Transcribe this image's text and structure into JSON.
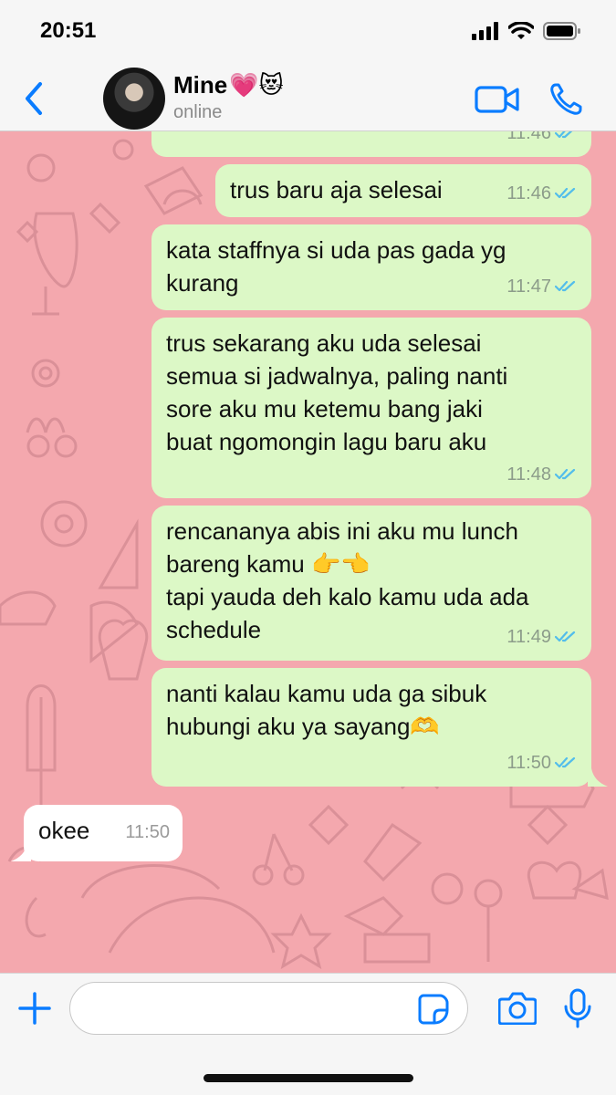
{
  "status_bar": {
    "time": "20:51"
  },
  "header": {
    "contact_name": "Mine",
    "contact_emoji": "💗😻",
    "status": "online"
  },
  "messages": [
    {
      "direction": "out",
      "text": "",
      "time": "11:46"
    },
    {
      "direction": "out",
      "text": "trus baru aja selesai",
      "time": "11:46"
    },
    {
      "direction": "out",
      "lines": [
        "kata staffnya si uda pas gada yg",
        "kurang"
      ],
      "time": "11:47"
    },
    {
      "direction": "out",
      "lines": [
        "trus sekarang aku uda selesai",
        "semua si jadwalnya, paling nanti",
        "sore aku mu ketemu bang jaki",
        "buat ngomongin lagu baru aku"
      ],
      "time": "11:48"
    },
    {
      "direction": "out",
      "lines": [
        "rencananya abis ini aku mu lunch",
        "bareng kamu 👉👈",
        "tapi yauda deh kalo kamu uda ada",
        "schedule"
      ],
      "time": "11:49"
    },
    {
      "direction": "out",
      "lines": [
        "nanti kalau kamu uda ga sibuk",
        "hubungi aku ya sayang🫶"
      ],
      "time": "11:50"
    },
    {
      "direction": "in",
      "text": "okee",
      "time": "11:50"
    }
  ],
  "input": {
    "placeholder": ""
  },
  "colors": {
    "accent": "#0a7cff",
    "outgoing_bubble": "#dcf8c6",
    "incoming_bubble": "#ffffff",
    "wallpaper": "#f4a8ae",
    "read_ticks": "#53bdeb"
  },
  "icons": {
    "back": "chevron-left-icon",
    "video": "video-camera-icon",
    "call": "phone-icon",
    "plus": "plus-icon",
    "sticker": "sticker-icon",
    "camera": "camera-icon",
    "mic": "microphone-icon"
  }
}
